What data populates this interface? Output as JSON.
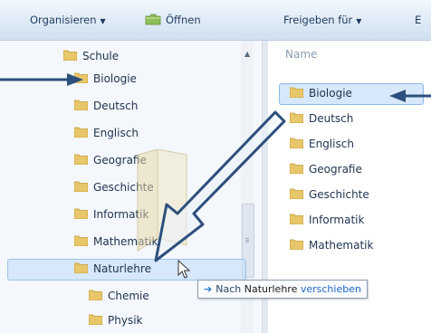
{
  "toolbar": {
    "organize_label": "Organisieren",
    "open_label": "Öffnen",
    "share_label": "Freigeben für",
    "overflow_label": "E"
  },
  "nav": {
    "items": [
      {
        "label": "Schule",
        "icon": "folder-icon"
      },
      {
        "label": "Biologie",
        "icon": "folder-icon"
      },
      {
        "label": "Deutsch",
        "icon": "folder-icon"
      },
      {
        "label": "Englisch",
        "icon": "folder-icon"
      },
      {
        "label": "Geografie",
        "icon": "folder-icon"
      },
      {
        "label": "Geschichte",
        "icon": "folder-icon"
      },
      {
        "label": "Informatik",
        "icon": "folder-icon"
      },
      {
        "label": "Mathematik",
        "icon": "folder-icon"
      },
      {
        "label": "Naturlehre",
        "icon": "folder-icon",
        "selected": true
      },
      {
        "label": "Chemie",
        "icon": "folder-icon"
      },
      {
        "label": "Physik",
        "icon": "folder-icon"
      }
    ]
  },
  "content": {
    "column_name": "Name",
    "items": [
      {
        "label": "Biologie",
        "selected": true
      },
      {
        "label": "Deutsch"
      },
      {
        "label": "Englisch"
      },
      {
        "label": "Geografie"
      },
      {
        "label": "Geschichte"
      },
      {
        "label": "Informatik"
      },
      {
        "label": "Mathematik"
      }
    ]
  },
  "drag_tooltip": {
    "prefix": "Nach",
    "target": "Naturlehre",
    "verb": "verschieben"
  },
  "colors": {
    "folder": "#e8c66a",
    "selection": "#cce4f7",
    "callout": "#2d4f7c"
  }
}
